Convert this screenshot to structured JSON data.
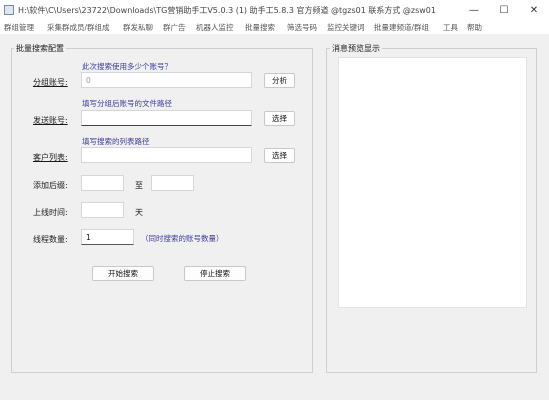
{
  "window": {
    "title": "H:\\软件\\C\\Users\\23722\\Downloads\\TG营销助手工V5.0.3 (1)  助手工5.8.3  官方频道 @tgzs01  联系方式 @zsw01",
    "controls": [
      "minimize",
      "maximize",
      "close"
    ]
  },
  "menu": {
    "items": [
      "群组管理",
      "采集群成员/群组成",
      "群发私聊",
      "群广告",
      "机器人监控",
      "批量搜索",
      "筛选号码",
      "监控关键词",
      "批量建频道/群组",
      "工具",
      "帮助"
    ]
  },
  "left_panel": {
    "title": "批量搜索配置",
    "account_count": {
      "hint": "此次搜索使用多少个账号？",
      "label": "分组账号:",
      "value": "0",
      "button": "分析"
    },
    "send_account": {
      "hint": "填写分组后账号的文件路径",
      "label": "发送账号:",
      "value": "",
      "button": "选择"
    },
    "customer_list": {
      "hint": "填写搜索的列表路径",
      "label": "客户列表:",
      "value": "",
      "button": "选择"
    },
    "add_delay": {
      "label": "添加后缀:",
      "from_value": "",
      "separator": "至",
      "to_value": ""
    },
    "online_time": {
      "label": "上线时间:",
      "value": "",
      "unit": "天"
    },
    "threads": {
      "label": "线程数量:",
      "value": "1",
      "hint": "（同时搜索的账号数量）"
    },
    "start_button": "开始搜索",
    "stop_button": "停止搜索"
  },
  "right_panel": {
    "title": "消息预览显示",
    "content": ""
  }
}
